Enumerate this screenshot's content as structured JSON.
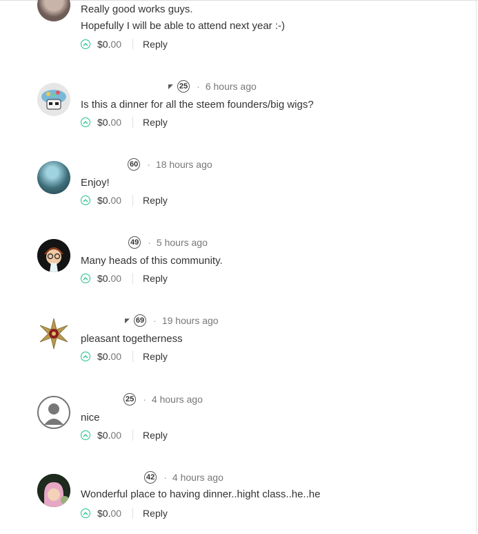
{
  "comments": [
    {
      "reputation": "",
      "time": "",
      "lines": [
        "Really good works guys.",
        "Hopefully I will be able to attend next year :-)"
      ],
      "payout_main": "$0.",
      "payout_cents": "00",
      "reply": "Reply"
    },
    {
      "reputation": "25",
      "time": "6 hours ago",
      "lines": [
        "Is this a dinner for all the steem founders/big wigs?"
      ],
      "payout_main": "$0.",
      "payout_cents": "00",
      "reply": "Reply"
    },
    {
      "reputation": "60",
      "time": "18 hours ago",
      "lines": [
        "Enjoy!"
      ],
      "payout_main": "$0.",
      "payout_cents": "00",
      "reply": "Reply"
    },
    {
      "reputation": "49",
      "time": "5 hours ago",
      "lines": [
        "Many heads of this community."
      ],
      "payout_main": "$0.",
      "payout_cents": "00",
      "reply": "Reply"
    },
    {
      "reputation": "69",
      "time": "19 hours ago",
      "lines": [
        "pleasant togetherness"
      ],
      "payout_main": "$0.",
      "payout_cents": "00",
      "reply": "Reply"
    },
    {
      "reputation": "25",
      "time": "4 hours ago",
      "lines": [
        "nice"
      ],
      "payout_main": "$0.",
      "payout_cents": "00",
      "reply": "Reply"
    },
    {
      "reputation": "42",
      "time": "4 hours ago",
      "lines": [
        "Wonderful place to having dinner..hight class..he..he"
      ],
      "payout_main": "$0.",
      "payout_cents": "00",
      "reply": "Reply"
    }
  ],
  "colors": {
    "upvote": "#1fbf8f",
    "text": "#333333",
    "muted": "#777777"
  },
  "icons": {
    "upvote": "chevron-up-circle-icon",
    "reputation": "reputation-badge",
    "dropdown": "dropdown-arrow-icon"
  }
}
